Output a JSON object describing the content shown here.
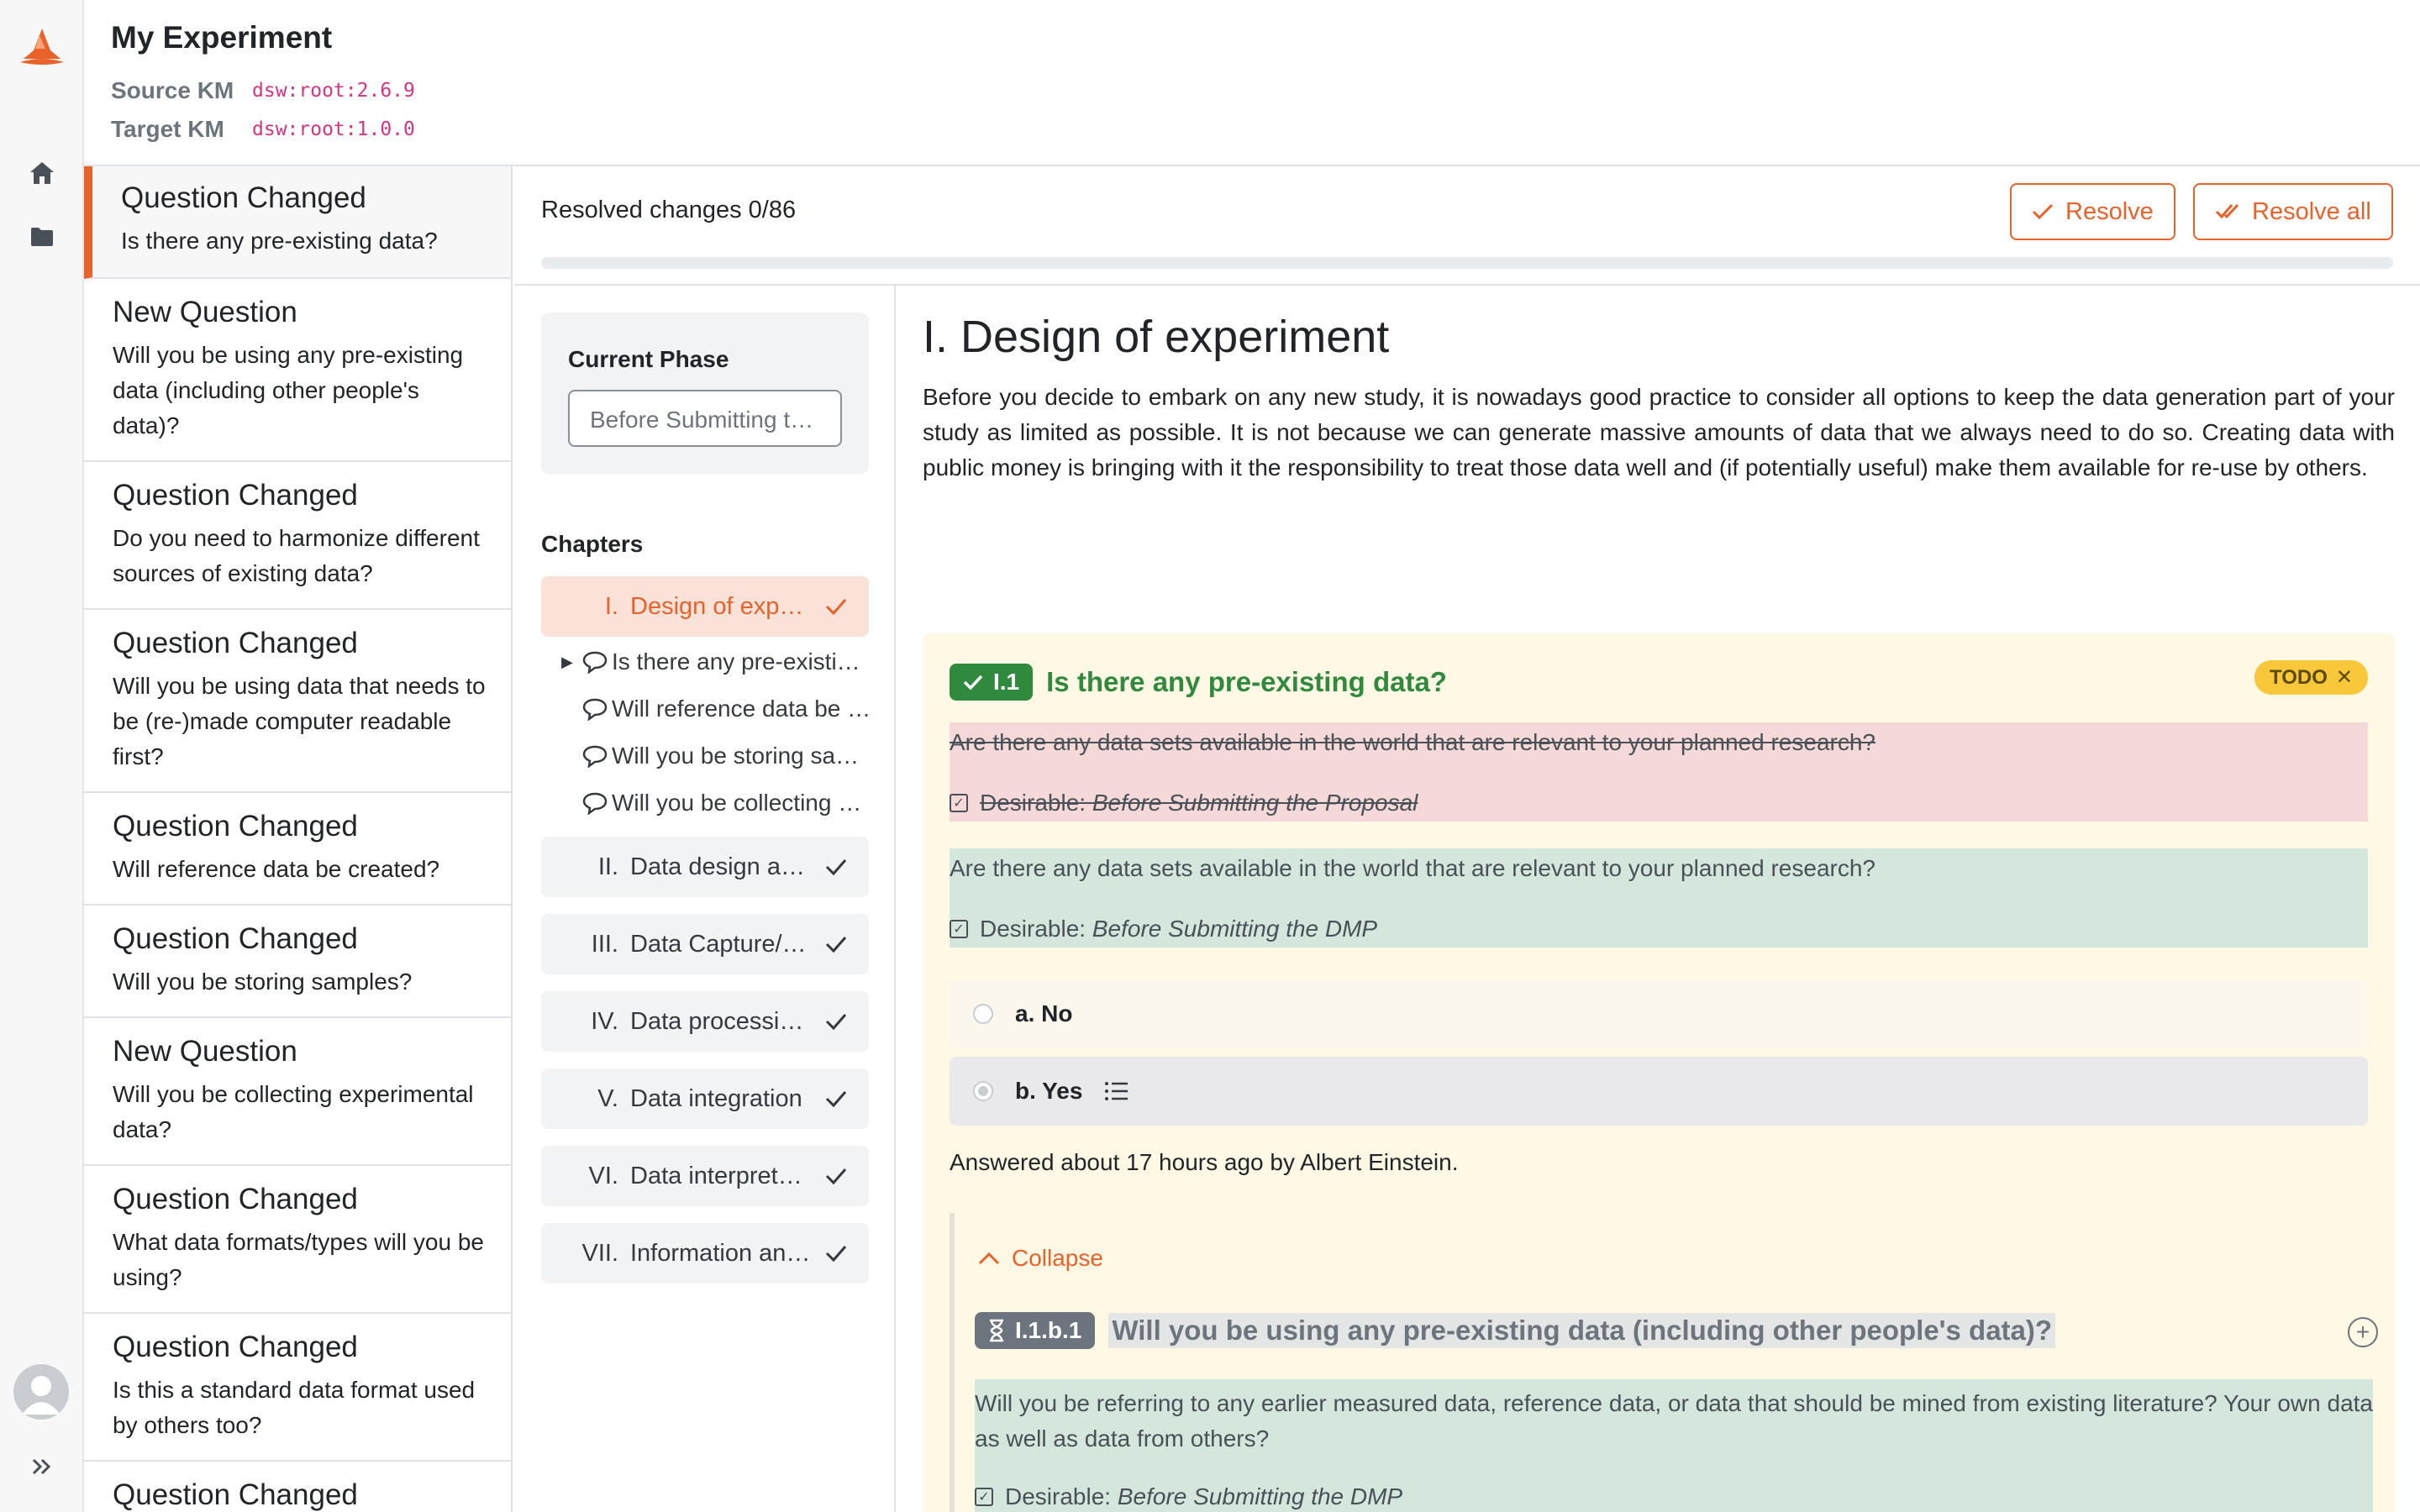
{
  "header": {
    "title": "My Experiment",
    "source_label": "Source KM",
    "source_value": "dsw:root:2.6.9",
    "target_label": "Target KM",
    "target_value": "dsw:root:1.0.0"
  },
  "changes": [
    {
      "type": "Question Changed",
      "text": "Is there any pre-existing data?"
    },
    {
      "type": "New Question",
      "text": "Will you be using any pre-existing data (including other people's data)?"
    },
    {
      "type": "Question Changed",
      "text": "Do you need to harmonize different sources of existing data?"
    },
    {
      "type": "Question Changed",
      "text": "Will you be using data that needs to be (re-)made computer readable first?"
    },
    {
      "type": "Question Changed",
      "text": "Will reference data be created?"
    },
    {
      "type": "Question Changed",
      "text": "Will you be storing samples?"
    },
    {
      "type": "New Question",
      "text": "Will you be collecting experimental data?"
    },
    {
      "type": "Question Changed",
      "text": "What data formats/types will you be using?"
    },
    {
      "type": "Question Changed",
      "text": "Is this a standard data format used by others too?"
    },
    {
      "type": "Question Changed",
      "text": ""
    }
  ],
  "toolbar": {
    "resolved_text": "Resolved changes 0/86",
    "progress": 0,
    "resolve_label": "Resolve",
    "resolve_all_label": "Resolve all"
  },
  "phase": {
    "label": "Current Phase",
    "selected": "Before Submitting the Proposal"
  },
  "chapters": {
    "title": "Chapters",
    "items": [
      {
        "num": "I.",
        "name": "Design of experiment"
      },
      {
        "num": "II.",
        "name": "Data design and planning"
      },
      {
        "num": "III.",
        "name": "Data Capture/Measurement"
      },
      {
        "num": "IV.",
        "name": "Data processing and curation"
      },
      {
        "num": "V.",
        "name": "Data integration"
      },
      {
        "num": "VI.",
        "name": "Data interpretation"
      },
      {
        "num": "VII.",
        "name": "Information and insight"
      }
    ],
    "questions": [
      "Is there any pre-existing data?",
      "Will reference data be created?",
      "Will you be storing samples?",
      "Will you be collecting experimental data?"
    ]
  },
  "content": {
    "chapter_title": "I. Design of experiment",
    "chapter_text": "Before you decide to embark on any new study, it is nowadays good practice to consider all options to keep the data generation part of your study as limited as possible. It is not because we can generate massive amounts of data that we always need to do so. Creating data with public money is bringing with it the responsibility to treat those data well and (if potentially useful) make them available for re-use by others.",
    "question": {
      "number": "I.1",
      "title": "Is there any pre-existing data?",
      "todo_label": "TODO",
      "old_text": "Are there any data sets available in the world that are relevant to your planned research?",
      "old_desirable_label": "Desirable:",
      "old_desirable_value": "Before Submitting the Proposal",
      "new_text": "Are there any data sets available in the world that are relevant to your planned research?",
      "new_desirable_label": "Desirable:",
      "new_desirable_value": "Before Submitting the DMP",
      "options": [
        {
          "label": "a. No"
        },
        {
          "label": "b. Yes"
        }
      ],
      "answered": "Answered about 17 hours ago by Albert Einstein."
    },
    "nested": {
      "collapse_label": "Collapse",
      "number": "I.1.b.1",
      "title": "Will you be using any pre-existing data (including other people's data)?",
      "text": "Will you be referring to any earlier measured data, reference data, or data that should be mined from existing literature? Your own data as well as data from others?",
      "desirable_label": "Desirable:",
      "desirable_value": "Before Submitting the DMP"
    }
  },
  "colors": {
    "accent": "#e8622a",
    "success": "#2f8a3e",
    "todo": "#f9c83a",
    "removed_bg": "#f5d9d8",
    "added_bg": "#d5e6dc",
    "question_bg": "#fff8e5"
  }
}
